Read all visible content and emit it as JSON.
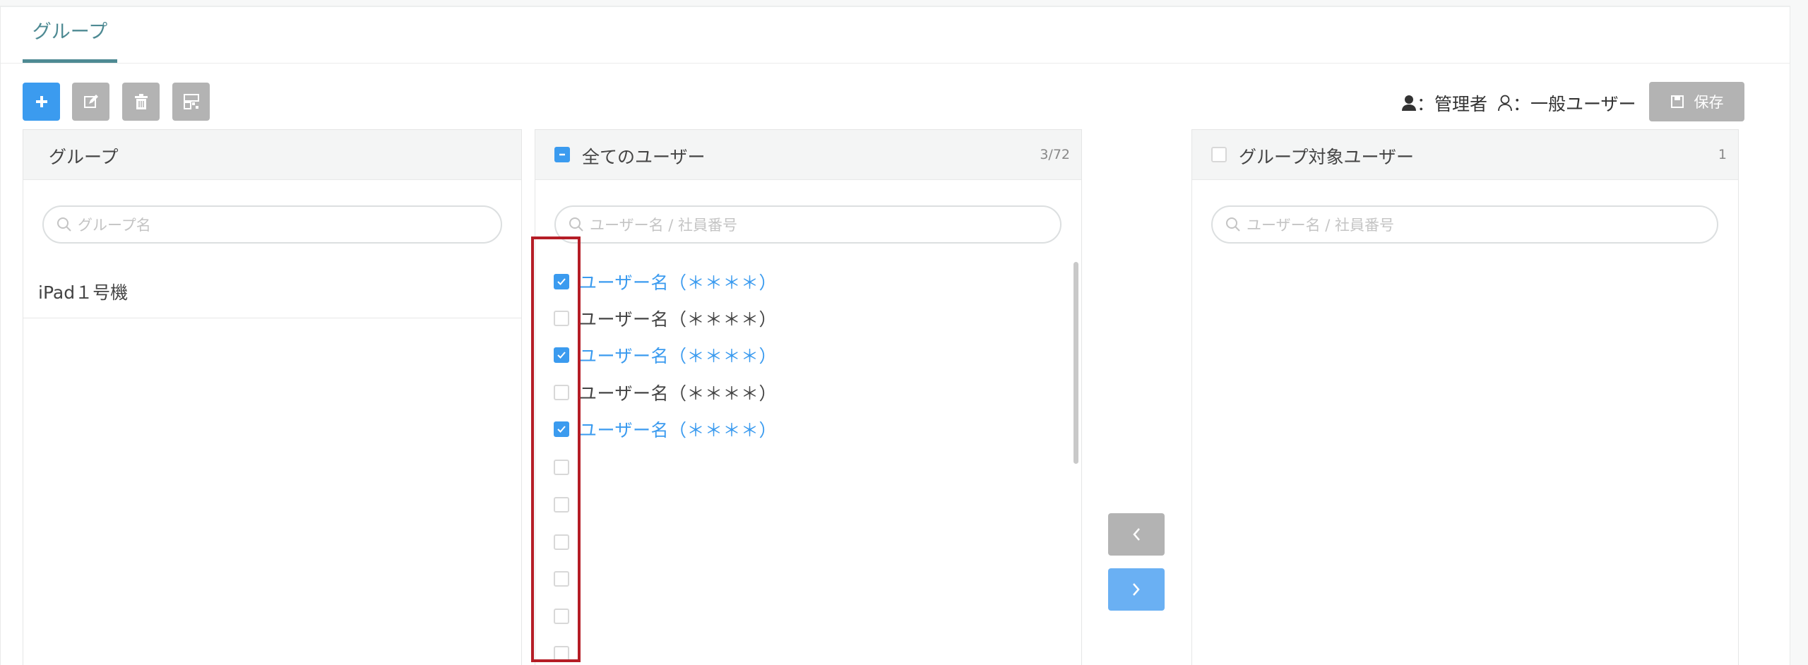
{
  "tabs": [
    {
      "label": "グループ"
    }
  ],
  "toolbar": {
    "add_label": "+",
    "legend_admin": "：管理者",
    "legend_general": "：一般ユーザー",
    "save_label": "保存"
  },
  "groups_panel": {
    "title": "グループ",
    "search_placeholder": "グループ名",
    "items": [
      {
        "label": "iPad１号機"
      }
    ]
  },
  "all_users_panel": {
    "title": "全てのユーザー",
    "count": "3/72",
    "search_placeholder": "ユーザー名 / 社員番号",
    "users": [
      {
        "label": "ユーザー名（＊＊＊＊）",
        "checked": true
      },
      {
        "label": "ユーザー名（＊＊＊＊）",
        "checked": false
      },
      {
        "label": "ユーザー名（＊＊＊＊）",
        "checked": true
      },
      {
        "label": "ユーザー名（＊＊＊＊）",
        "checked": false
      },
      {
        "label": "ユーザー名（＊＊＊＊）",
        "checked": true
      },
      {
        "label": "",
        "checked": false
      },
      {
        "label": "",
        "checked": false
      },
      {
        "label": "",
        "checked": false
      },
      {
        "label": "",
        "checked": false
      },
      {
        "label": "",
        "checked": false
      },
      {
        "label": "",
        "checked": false
      }
    ]
  },
  "target_users_panel": {
    "title": "グループ対象ユーザー",
    "count": "1",
    "search_placeholder": "ユーザー名 / 社員番号"
  },
  "transfer": {
    "left_label": "‹",
    "right_label": "›"
  },
  "colors": {
    "accent": "#3b9bef",
    "tab": "#4e8a93",
    "disabled": "#b3b3b3",
    "highlight": "#b51d26"
  }
}
